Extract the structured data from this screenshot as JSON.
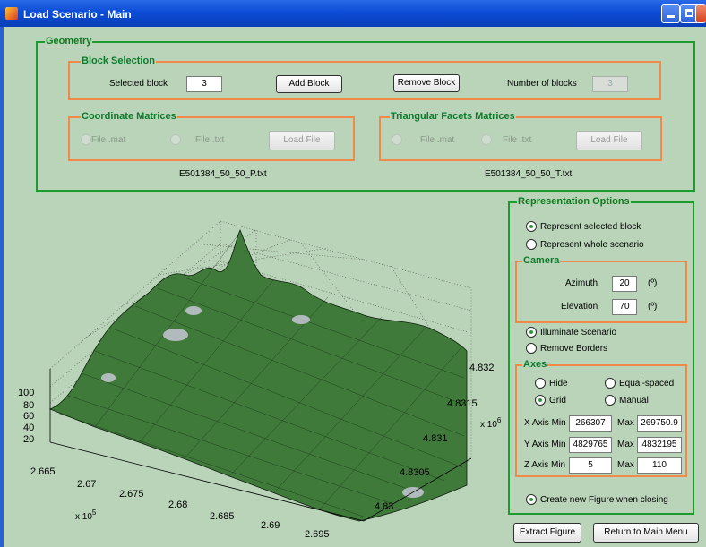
{
  "window": {
    "title": "Load Scenario - Main"
  },
  "geometry": {
    "title": "Geometry",
    "block_selection": {
      "title": "Block Selection",
      "selected_block_label": "Selected block",
      "selected_block_value": "3",
      "add_block": "Add Block",
      "remove_block": "Remove Block",
      "number_of_blocks_label": "Number of blocks",
      "number_of_blocks_value": "3"
    },
    "coordinate_matrices": {
      "title": "Coordinate Matrices",
      "file_mat": "File .mat",
      "file_txt": "File .txt",
      "load_file": "Load File",
      "filename": "E501384_50_50_P.txt"
    },
    "triangular_facets": {
      "title": "Triangular Facets Matrices",
      "file_mat": "File .mat",
      "file_txt": "File .txt",
      "load_file": "Load File",
      "filename": "E501384_50_50_T.txt"
    }
  },
  "representation": {
    "title": "Representation Options",
    "represent_selected": "Represent selected block",
    "represent_whole": "Represent whole scenario",
    "selected_mode": "Represent selected block",
    "camera": {
      "title": "Camera",
      "azimuth_label": "Azimuth",
      "azimuth_value": "20",
      "azimuth_unit": "(º)",
      "elevation_label": "Elevation",
      "elevation_value": "70",
      "elevation_unit": "(º)"
    },
    "illuminate": "Illuminate Scenario",
    "remove_borders": "Remove Borders",
    "axes": {
      "title": "Axes",
      "hide": "Hide",
      "equal_spaced": "Equal-spaced",
      "grid": "Grid",
      "manual": "Manual",
      "x_min_label": "X Axis Min",
      "x_min": "266307",
      "x_max_label": "Max",
      "x_max": "269750.9",
      "y_min_label": "Y Axis Min",
      "y_min": "4829765",
      "y_max_label": "Max",
      "y_max": "4832195",
      "z_min_label": "Z Axis Min",
      "z_min": "5",
      "z_max_label": "Max",
      "z_max": "110"
    },
    "create_new_figure": "Create new Figure when closing"
  },
  "buttons": {
    "extract_figure": "Extract Figure",
    "return_main": "Return to Main Menu"
  },
  "plot": {
    "z_ticks": [
      "100",
      "80",
      "60",
      "40",
      "20"
    ],
    "x_ticks": [
      "2.665",
      "2.67",
      "2.675",
      "2.68",
      "2.685",
      "2.69",
      "2.695"
    ],
    "x_exponent": "x 10",
    "x_exponent_power": "5",
    "y_ticks": [
      "4.832",
      "4.8315",
      "4.831",
      "4.8305",
      "4.83"
    ],
    "y_exponent": "x 10",
    "y_exponent_power": "6",
    "surface_color": "#3f7a3a"
  }
}
